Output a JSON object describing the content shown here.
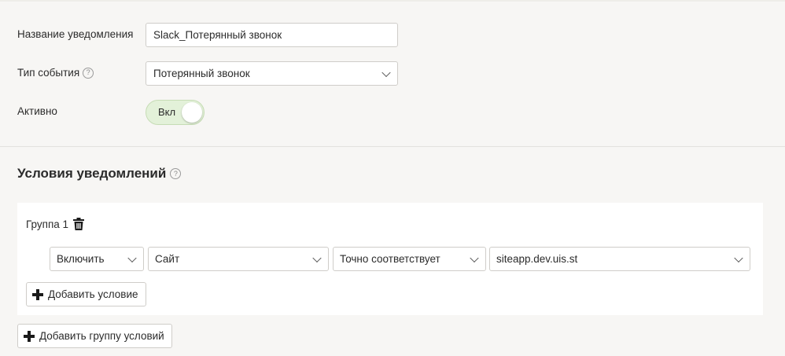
{
  "form": {
    "name_label": "Название уведомления",
    "name_value": "Slack_Потерянный звонок",
    "event_type_label": "Тип события",
    "event_type_value": "Потерянный звонок",
    "active_label": "Активно",
    "active_toggle_label": "Вкл",
    "active_state": "on"
  },
  "conditions": {
    "title": "Условия уведомлений",
    "groups": [
      {
        "title": "Группа 1",
        "conditions": [
          {
            "mode": "Включить",
            "field": "Сайт",
            "operator": "Точно соответствует",
            "value": "siteapp.dev.uis.st"
          }
        ],
        "add_condition_label": "Добавить условие"
      }
    ],
    "add_group_label": "Добавить группу условий"
  },
  "icons": {
    "help": "help-circle-icon",
    "trash": "trash-icon",
    "plus": "plus-icon",
    "chevron": "chevron-down-icon"
  },
  "colors": {
    "background": "#f7f6f4",
    "toggle_on_bg": "#e3f1d9",
    "toggle_on_border": "#c6dcb5",
    "card_bg": "#ffffff",
    "border": "#cfcdc9"
  }
}
